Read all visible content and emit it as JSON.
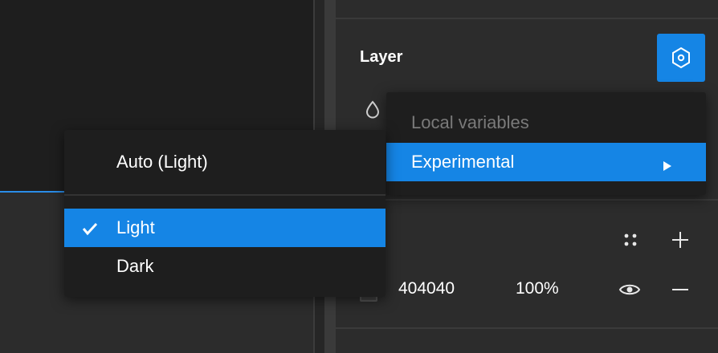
{
  "panel": {
    "layer_title": "Layer"
  },
  "fill": {
    "hex": "404040",
    "opacity": "100%",
    "swatch_color": "#404040"
  },
  "icons": {
    "mode": "variable-mode-icon",
    "drop": "drop-icon",
    "styles": "styles-grid-icon",
    "add": "plus-icon",
    "visibility": "eye-icon",
    "remove": "minus-icon",
    "check": "check-icon",
    "submenu": "chevron-right-icon"
  },
  "mode_menu": {
    "header": "Local variables",
    "items": [
      {
        "label": "Experimental",
        "highlighted": true,
        "has_submenu": true
      }
    ]
  },
  "theme_menu": {
    "items": [
      {
        "label": "Auto (Light)",
        "selected": false
      },
      {
        "label": "Light",
        "selected": true
      },
      {
        "label": "Dark",
        "selected": false
      }
    ]
  },
  "colors": {
    "accent": "#1585e5",
    "menu_bg": "#1e1e1e",
    "panel_bg": "#2c2c2c"
  }
}
